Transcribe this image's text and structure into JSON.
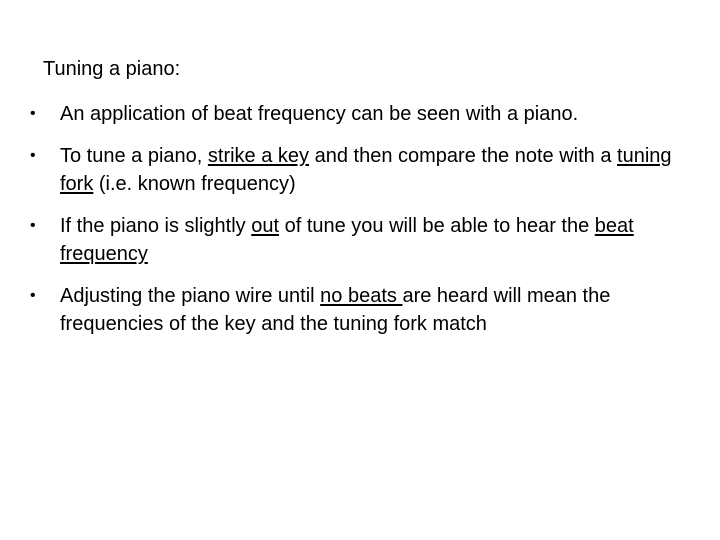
{
  "slide": {
    "title": "Tuning a piano:",
    "bullet_glyph": "•",
    "bullets": [
      {
        "segments": [
          {
            "text": "An application of beat frequency can be seen with a piano.",
            "underline": false
          }
        ]
      },
      {
        "segments": [
          {
            "text": "To tune a piano, ",
            "underline": false
          },
          {
            "text": "strike a key",
            "underline": true
          },
          {
            "text": " and then compare the note with a ",
            "underline": false
          },
          {
            "text": "tuning fork",
            "underline": true
          },
          {
            "text": " (i.e. known frequency)",
            "underline": false
          }
        ]
      },
      {
        "segments": [
          {
            "text": "If the piano is slightly ",
            "underline": false
          },
          {
            "text": "out",
            "underline": true
          },
          {
            "text": " of tune you will be able to hear the ",
            "underline": false
          },
          {
            "text": "beat frequency",
            "underline": true
          }
        ]
      },
      {
        "segments": [
          {
            "text": "Adjusting the piano wire until ",
            "underline": false
          },
          {
            "text": "no beats ",
            "underline": true
          },
          {
            "text": "are heard will mean the frequencies of the key and the tuning fork match",
            "underline": false
          }
        ]
      }
    ]
  }
}
